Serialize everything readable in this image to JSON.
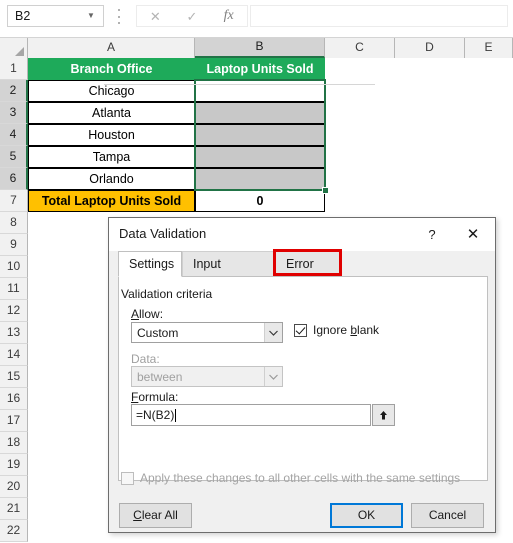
{
  "formula_bar": {
    "name_box_value": "B2",
    "name_box_icon": "chevron-down-icon",
    "cancel_icon": "times-icon",
    "enter_icon": "check-icon",
    "function_icon": "fx-icon",
    "formula_value": ""
  },
  "grid": {
    "columns": [
      "A",
      "B",
      "C",
      "D",
      "E"
    ],
    "active_column": "B",
    "rows": [
      "1",
      "2",
      "3",
      "4",
      "5",
      "6",
      "7",
      "8",
      "9",
      "10",
      "11",
      "12",
      "13",
      "14",
      "15",
      "16",
      "17",
      "18",
      "19",
      "20",
      "21",
      "22"
    ],
    "selected_rows": [
      "2",
      "3",
      "4",
      "5",
      "6"
    ],
    "header_row": {
      "a": "Branch Office",
      "b": "Laptop Units Sold",
      "bg": "#1EAA5A",
      "fg": "#FFFFFF"
    },
    "data_rows": [
      {
        "office": "Chicago",
        "units": ""
      },
      {
        "office": "Atlanta",
        "units": ""
      },
      {
        "office": "Houston",
        "units": ""
      },
      {
        "office": "Tampa",
        "units": ""
      },
      {
        "office": "Orlando",
        "units": ""
      }
    ],
    "total_row": {
      "label": "Total Laptop Units Sold",
      "value": "0",
      "bg": "#FFC000",
      "fg": "#000000"
    },
    "selection_color": "#217346"
  },
  "dialog": {
    "title": "Data Validation",
    "help_label": "?",
    "close_label": "✕",
    "tabs": [
      {
        "label": "Settings",
        "active": true,
        "highlighted": false
      },
      {
        "label": "Input Message",
        "active": false,
        "highlighted": false
      },
      {
        "label": "Error Alert",
        "active": false,
        "highlighted": true
      }
    ],
    "highlight_color": "#E00000",
    "group_title": "Validation criteria",
    "allow": {
      "label": "Allow:",
      "label_accel": "A",
      "value": "Custom",
      "disabled": false
    },
    "ignore_blank": {
      "label": "Ignore blank",
      "label_accel": "b",
      "checked": true
    },
    "data": {
      "label": "Data:",
      "value": "between",
      "disabled": true
    },
    "formula": {
      "label": "Formula:",
      "label_accel": "F",
      "value": "=N(B2)",
      "range_button_icon": "range-select-up-arrow-icon"
    },
    "apply_all": {
      "label": "Apply these changes to all other cells with the same settings",
      "checked": false,
      "disabled": true
    },
    "buttons": {
      "clear_all": "Clear All",
      "clear_all_accel": "C",
      "ok": "OK",
      "cancel": "Cancel",
      "default_button": "OK",
      "focus_color": "#0078D7"
    }
  }
}
